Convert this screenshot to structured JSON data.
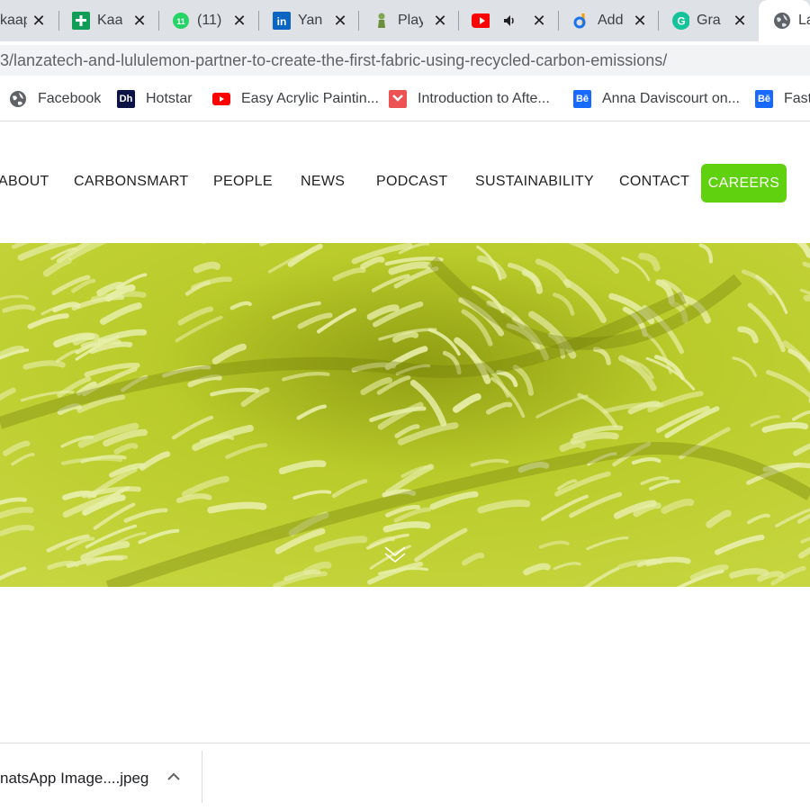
{
  "browser": {
    "tabs": [
      {
        "title": "kaap",
        "icon": "globe-icon"
      },
      {
        "title": "Kaa",
        "icon": "sheets-icon"
      },
      {
        "title": "(11)",
        "icon": "whatsapp-icon"
      },
      {
        "title": "Yan",
        "icon": "linkedin-icon"
      },
      {
        "title": "Play",
        "icon": "chess-pawn-icon"
      },
      {
        "title": "",
        "icon": "youtube-icon",
        "audio": true
      },
      {
        "title": "Add",
        "icon": "d-logo-icon"
      },
      {
        "title": "Gra",
        "icon": "grammarly-icon"
      },
      {
        "title": "La",
        "icon": "globe-icon",
        "active": true
      }
    ],
    "url": "3/lanzatech-and-lululemon-partner-to-create-the-first-fabric-using-recycled-carbon-emissions/",
    "bookmarks": [
      {
        "label": "Facebook",
        "icon": "globe-icon"
      },
      {
        "label": "Hotstar",
        "icon": "hotstar-icon",
        "badge": "Dh"
      },
      {
        "label": "Easy Acrylic Paintin...",
        "icon": "youtube-icon"
      },
      {
        "label": "Introduction to Afte...",
        "icon": "udemy-icon"
      },
      {
        "label": "Anna Daviscourt on...",
        "icon": "behance-icon",
        "badge": "Bē"
      },
      {
        "label": "Fast",
        "icon": "behance-icon",
        "badge": "Bē"
      }
    ]
  },
  "site": {
    "nav": [
      "ABOUT",
      "CARBONSMART",
      "PEOPLE",
      "NEWS",
      "PODCAST",
      "SUSTAINABILITY",
      "CONTACT"
    ],
    "careers_label": "CAREERS",
    "accent_color": "#5fd10f",
    "hero_icon": "chevron-down-icon"
  },
  "download_bar": {
    "filename": "natsApp Image....jpeg",
    "icon": "chevron-up-icon"
  }
}
